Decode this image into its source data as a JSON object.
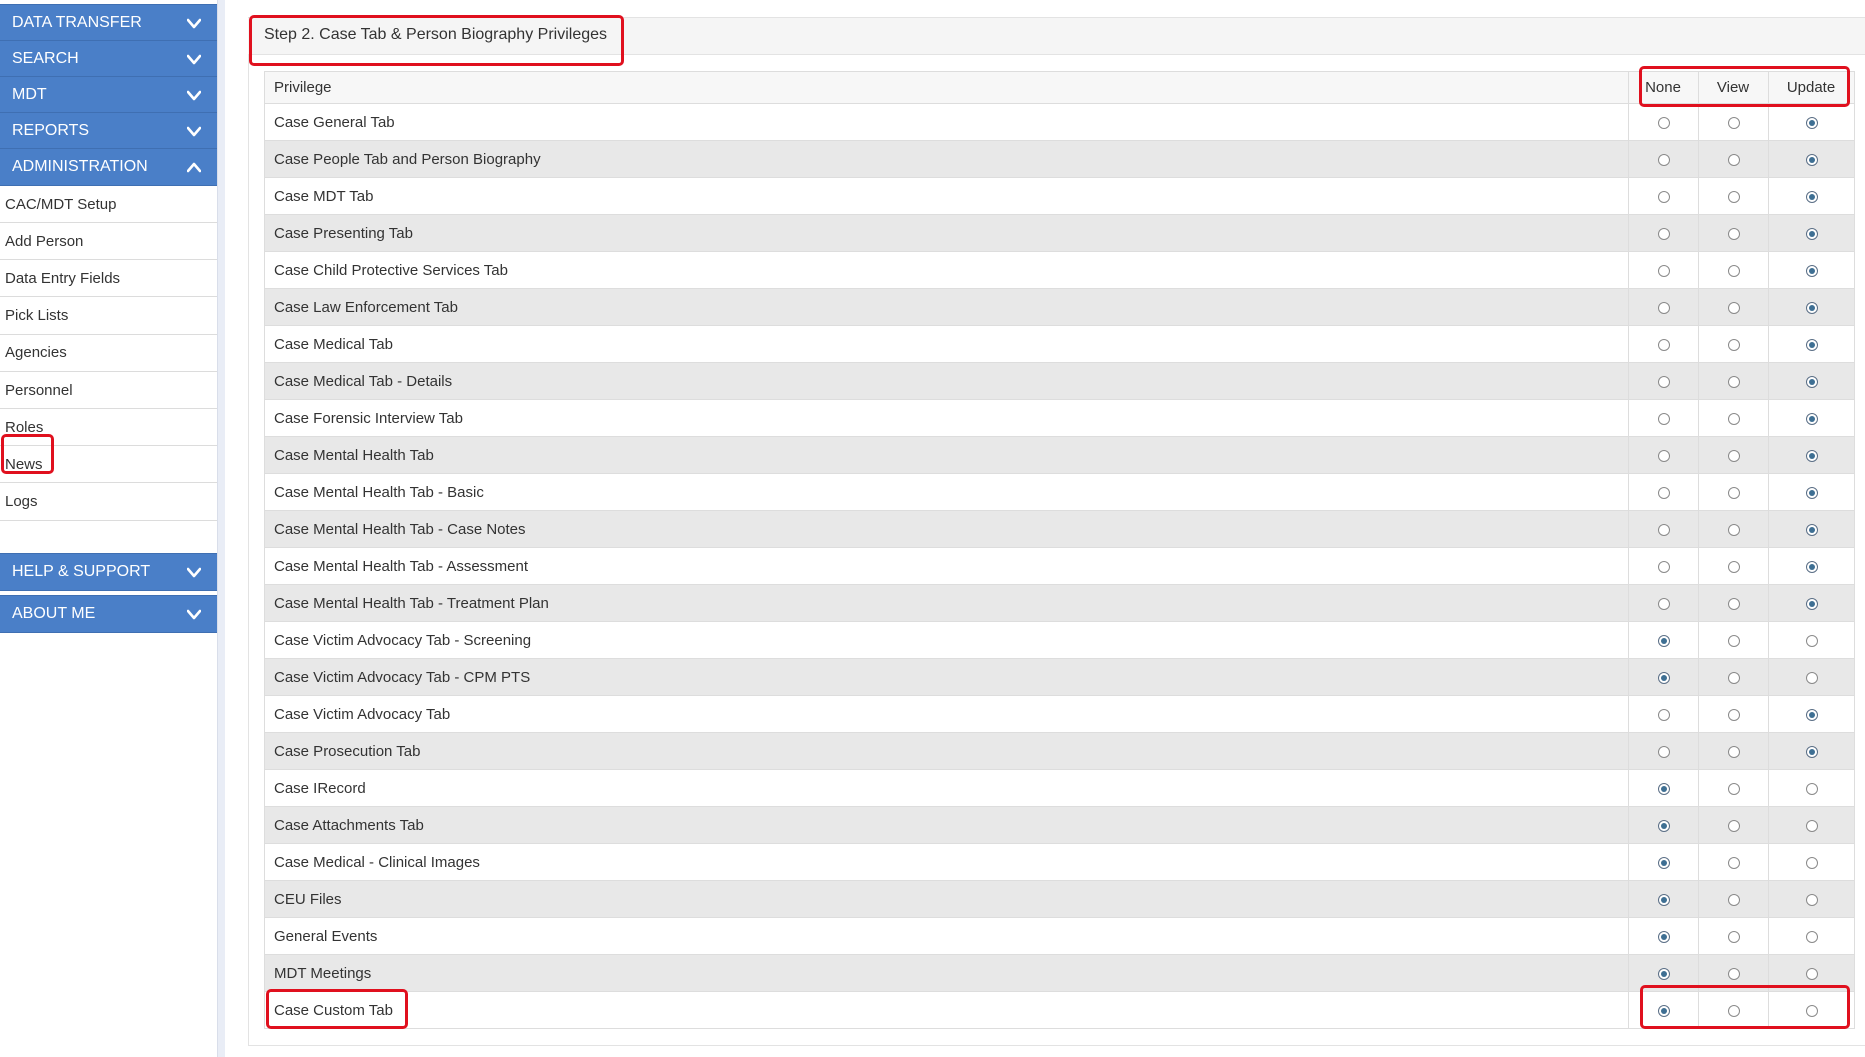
{
  "sidebar": {
    "sections_top": [
      {
        "label": "DATA TRANSFER",
        "chevron": "chevron-down-icon"
      },
      {
        "label": "SEARCH",
        "chevron": "chevron-down-icon"
      },
      {
        "label": "MDT",
        "chevron": "chevron-down-icon"
      },
      {
        "label": "REPORTS",
        "chevron": "chevron-down-icon"
      },
      {
        "label": "ADMINISTRATION",
        "chevron": "chevron-up-icon"
      }
    ],
    "admin_items": [
      {
        "label": "CAC/MDT Setup"
      },
      {
        "label": "Add Person"
      },
      {
        "label": "Data Entry Fields"
      },
      {
        "label": "Pick Lists"
      },
      {
        "label": "Agencies"
      },
      {
        "label": "Personnel"
      },
      {
        "label": "Roles"
      },
      {
        "label": "News"
      },
      {
        "label": "Logs"
      }
    ],
    "sections_bottom": [
      {
        "label": "HELP & SUPPORT",
        "chevron": "chevron-down-icon"
      },
      {
        "label": "ABOUT ME",
        "chevron": "chevron-down-icon"
      }
    ]
  },
  "panel": {
    "title": "Step 2. Case Tab & Person Biography Privileges"
  },
  "table": {
    "headers": {
      "privilege": "Privilege",
      "none": "None",
      "view": "View",
      "update": "Update"
    },
    "rows": [
      {
        "label": "Case General Tab",
        "selected": "update"
      },
      {
        "label": "Case People Tab and Person Biography",
        "selected": "update"
      },
      {
        "label": "Case MDT Tab",
        "selected": "update"
      },
      {
        "label": "Case Presenting Tab",
        "selected": "update"
      },
      {
        "label": "Case Child Protective Services Tab",
        "selected": "update"
      },
      {
        "label": "Case Law Enforcement Tab",
        "selected": "update"
      },
      {
        "label": "Case Medical Tab",
        "selected": "update"
      },
      {
        "label": "Case Medical Tab - Details",
        "selected": "update"
      },
      {
        "label": "Case Forensic Interview Tab",
        "selected": "update"
      },
      {
        "label": "Case Mental Health Tab",
        "selected": "update"
      },
      {
        "label": "Case Mental Health Tab - Basic",
        "selected": "update"
      },
      {
        "label": "Case Mental Health Tab - Case Notes",
        "selected": "update"
      },
      {
        "label": "Case Mental Health Tab - Assessment",
        "selected": "update"
      },
      {
        "label": "Case Mental Health Tab - Treatment Plan",
        "selected": "update"
      },
      {
        "label": "Case Victim Advocacy Tab - Screening",
        "selected": "none"
      },
      {
        "label": "Case Victim Advocacy Tab - CPM PTS",
        "selected": "none"
      },
      {
        "label": "Case Victim Advocacy Tab",
        "selected": "update"
      },
      {
        "label": "Case Prosecution Tab",
        "selected": "update"
      },
      {
        "label": "Case IRecord",
        "selected": "none"
      },
      {
        "label": "Case Attachments Tab",
        "selected": "none"
      },
      {
        "label": "Case Medical - Clinical Images",
        "selected": "none"
      },
      {
        "label": "CEU Files",
        "selected": "none"
      },
      {
        "label": "General Events",
        "selected": "none"
      },
      {
        "label": "MDT Meetings",
        "selected": "none"
      },
      {
        "label": "Case Custom Tab",
        "selected": "none"
      }
    ]
  },
  "colors": {
    "nav_blue": "#4a7fc8",
    "highlight_red": "#e0101e",
    "radio_selected": "#3e6f93",
    "row_alt": "#e8e8e8"
  }
}
